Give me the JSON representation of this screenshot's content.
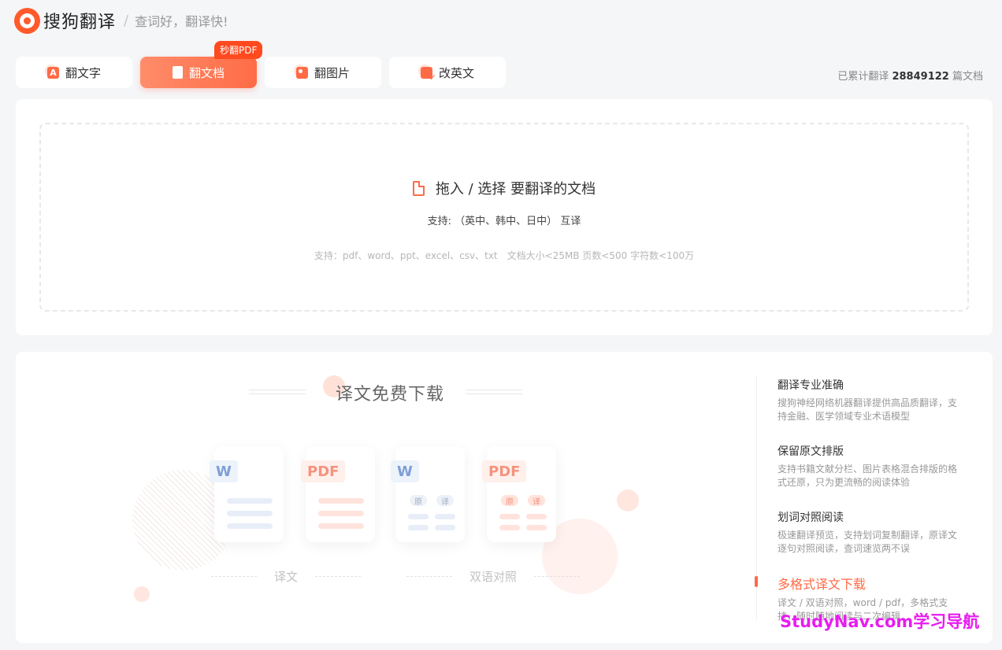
{
  "header": {
    "brand": "搜狗翻译",
    "separator": "/",
    "slogan": "查词好，翻译快!"
  },
  "tabs": [
    {
      "label": "翻文字",
      "icon": "text-translate-icon",
      "icon_glyph": "A",
      "active": false
    },
    {
      "label": "翻文档",
      "icon": "document-icon",
      "icon_glyph": "",
      "active": true
    },
    {
      "label": "翻图片",
      "icon": "image-icon",
      "icon_glyph": "",
      "active": false
    },
    {
      "label": "改英文",
      "icon": "edit-english-icon",
      "icon_glyph": "",
      "active": false
    }
  ],
  "tab_badge": "秒翻PDF",
  "counter": {
    "prefix": "已累计翻译",
    "value": "28849122",
    "suffix": "篇文档"
  },
  "upload": {
    "title": "拖入 / 选择 要翻译的文档",
    "support_langs": "支持: （英中、韩中、日中） 互译",
    "formats": "支持：pdf、word、ppt、excel、csv、txt　文档大小<25MB 页数<500 字符数<100万"
  },
  "feature": {
    "title": "译文免费下载",
    "cards": [
      {
        "tag": "W",
        "kind": "word",
        "layout": "single"
      },
      {
        "tag": "PDF",
        "kind": "pdf",
        "layout": "single"
      },
      {
        "tag": "W",
        "kind": "word",
        "layout": "bilingual",
        "chip_left": "原",
        "chip_right": "译"
      },
      {
        "tag": "PDF",
        "kind": "pdf",
        "layout": "bilingual",
        "chip_left": "原",
        "chip_right": "译"
      }
    ],
    "caption_single": "译文",
    "caption_bilingual": "双语对照"
  },
  "features_list": [
    {
      "title": "翻译专业准确",
      "desc": "搜狗神经网络机器翻译提供高品质翻译，支持金融、医学领域专业术语模型",
      "active": false
    },
    {
      "title": "保留原文排版",
      "desc": "支持书籍文献分栏、图片表格混合排版的格式还原，只为更流畅的阅读体验",
      "active": false
    },
    {
      "title": "划词对照阅读",
      "desc": "极速翻译预览，支持划词复制翻译，原译文逐句对照阅读，查词速览两不误",
      "active": false
    },
    {
      "title": "多格式译文下载",
      "desc": "译文 / 双语对照，word / pdf，多格式支持，随时随地阅读与二次编辑",
      "active": true
    }
  ],
  "watermark": "StudyNav.com学习导航",
  "colors": {
    "accent": "#ff6a46",
    "badge": "#ff4a1f",
    "watermark": "#e81cf0"
  }
}
